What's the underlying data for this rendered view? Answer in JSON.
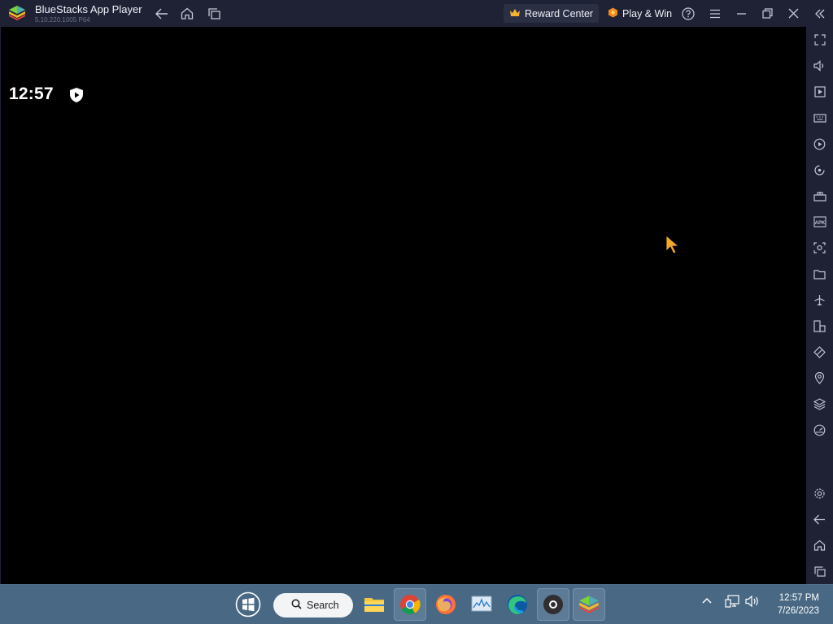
{
  "titlebar": {
    "app_title": "BlueStacks App Player",
    "app_version": "5.10.220.1005  P64",
    "reward_label": "Reward Center",
    "play_label": "Play & Win",
    "nav_icons": [
      "back-icon",
      "home-icon",
      "recent-apps-icon"
    ],
    "window_icons": [
      "help-icon",
      "menu-icon",
      "minimize-icon",
      "restore-icon",
      "close-icon",
      "collapse-sidebar-icon"
    ]
  },
  "android": {
    "clock": "12:57",
    "status_icon": "shield-play-icon"
  },
  "sidebar": {
    "items": [
      "fullscreen-icon",
      "volume-icon",
      "media-manager-icon",
      "keyboard-controls-icon",
      "macro-recorder-icon",
      "rotate-icon",
      "game-controls-icon",
      "install-apk-icon",
      "screenshot-icon",
      "folder-icon",
      "airplane-mode-icon",
      "multi-instance-icon",
      "eco-mode-icon",
      "location-icon",
      "layers-icon",
      "performance-icon"
    ],
    "bottom_items": [
      "settings-icon",
      "back-icon",
      "home-icon",
      "recent-apps-icon"
    ]
  },
  "taskbar": {
    "search_label": "Search",
    "apps": [
      "start-icon",
      "file-explorer-icon",
      "chrome-icon",
      "firefox-icon",
      "resource-monitor-icon",
      "edge-icon",
      "obs-icon",
      "bluestacks-icon"
    ],
    "time": "12:57 PM",
    "date": "7/26/2023"
  },
  "colors": {
    "titlebar_bg": "#1e2234",
    "taskbar_bg": "#486883",
    "accent": "#f0a92a"
  }
}
